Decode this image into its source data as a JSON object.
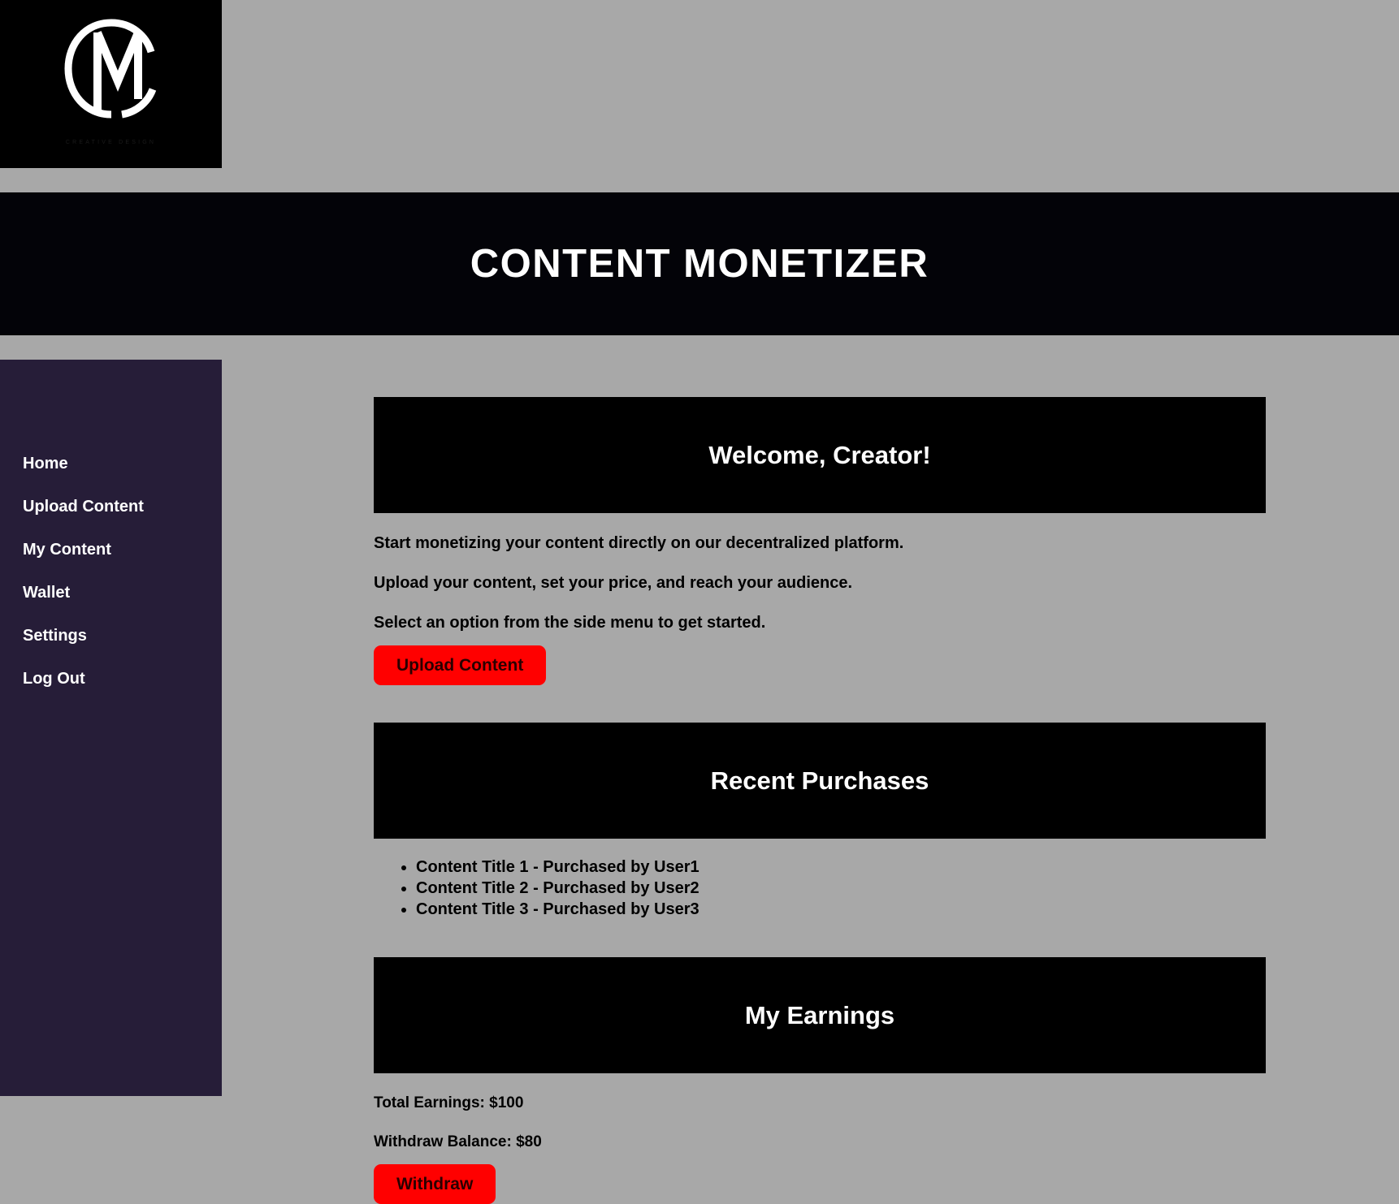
{
  "brand": {
    "logo_icon": "cm-monogram-logo",
    "tagline": "CREATIVE DESIGN"
  },
  "header": {
    "title": "CONTENT MONETIZER",
    "background_color": "#030308",
    "text_color": "#ffffff"
  },
  "page": {
    "background_color": "#a8a8a8"
  },
  "sidebar": {
    "background_color": "#261d38",
    "items": [
      {
        "label": "Home"
      },
      {
        "label": "Upload Content"
      },
      {
        "label": "My Content"
      },
      {
        "label": "Wallet"
      },
      {
        "label": "Settings"
      },
      {
        "label": "Log Out"
      }
    ]
  },
  "main": {
    "welcome": {
      "heading": "Welcome, Creator!",
      "paragraphs": [
        "Start monetizing your content directly on our decentralized platform.",
        "Upload your content, set your price, and reach your audience.",
        "Select an option from the side menu to get started."
      ],
      "upload_button_label": "Upload Content"
    },
    "recent_purchases": {
      "heading": "Recent Purchases",
      "items": [
        "Content Title 1 - Purchased by User1",
        "Content Title 2 - Purchased by User2",
        "Content Title 3 - Purchased by User3"
      ]
    },
    "earnings": {
      "heading": "My Earnings",
      "total_earnings_label": "Total Earnings: $100",
      "withdraw_balance_label": "Withdraw Balance: $80",
      "withdraw_button_label": "Withdraw"
    }
  },
  "accent_colors": {
    "button_red": "#ff0000",
    "panel_black": "#000000"
  }
}
